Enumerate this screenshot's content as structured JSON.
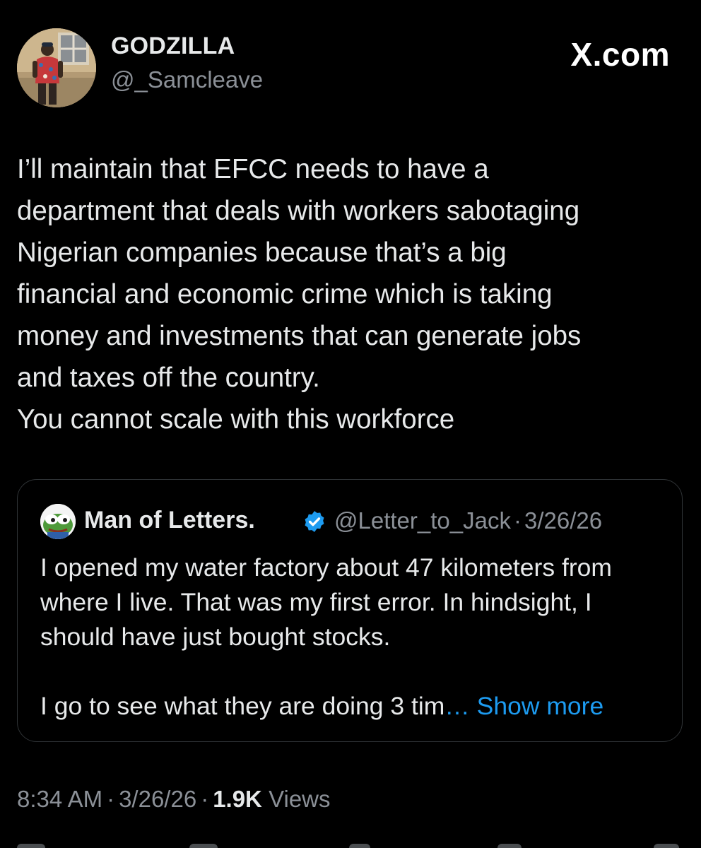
{
  "author": {
    "display_name": "GODZILLA",
    "handle": "@_Samcleave"
  },
  "brand": {
    "label": "X.com"
  },
  "tweet": {
    "text": "I’ll maintain that EFCC needs to have a\ndepartment that deals with workers sabotaging\nNigerian companies because that’s a big\nfinancial and economic crime which is taking\nmoney and investments that can generate jobs\nand taxes off the country.\nYou cannot scale with this workforce"
  },
  "quoted_tweet": {
    "display_name": "Man of Letters.",
    "handle": "@Letter_to_Jack",
    "separator": "·",
    "date": "3/26/26",
    "paragraph_1": "I opened my water factory about 47 kilometers from where I live. That was my first error. In hindsight, I should have just bought stocks.",
    "paragraph_2": "I go to see what they are doing 3 tim",
    "show_more_label": "… Show more"
  },
  "meta": {
    "time": "8:34 AM",
    "separator": "·",
    "date": "3/26/26",
    "views_count": "1.9K",
    "views_label": "Views"
  },
  "colors": {
    "background": "#000000",
    "text_primary": "#e7e9ea",
    "text_secondary": "#8b9097",
    "link": "#1d9bf0",
    "border": "#2f3336",
    "verified": "#1d9bf0"
  },
  "icons": {
    "verified": "verified-badge-icon"
  }
}
